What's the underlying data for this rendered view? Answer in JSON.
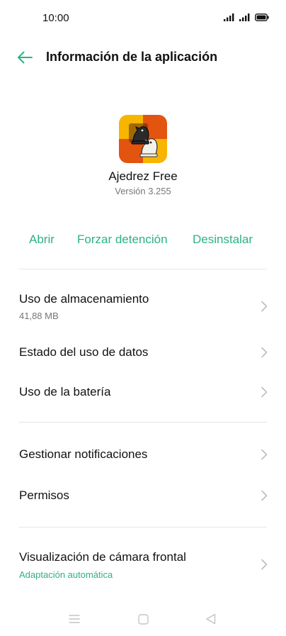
{
  "status_bar": {
    "time": "10:00",
    "icons": [
      "signal-icon",
      "signal-icon",
      "battery-icon"
    ]
  },
  "header": {
    "title": "Información de la aplicación",
    "back_icon": "arrow-left-icon"
  },
  "app": {
    "name": "Ajedrez Free",
    "version": "Versión 3.255",
    "icon": "chess-knights-icon"
  },
  "actions": {
    "open": "Abrir",
    "force_stop": "Forzar detención",
    "uninstall": "Desinstalar"
  },
  "settings": {
    "storage": {
      "title": "Uso de almacenamiento",
      "subtitle": "41,88 MB"
    },
    "data_usage": {
      "title": "Estado del uso de datos"
    },
    "battery": {
      "title": "Uso de la batería"
    },
    "notifications": {
      "title": "Gestionar notificaciones"
    },
    "permissions": {
      "title": "Permisos"
    },
    "front_camera": {
      "title": "Visualización de cámara frontal",
      "subtitle": "Adaptación automática"
    }
  },
  "nav_bar": {
    "icons": [
      "menu-icon",
      "home-icon",
      "back-triangle-icon"
    ]
  },
  "colors": {
    "accent": "#2bb383",
    "text": "#111111",
    "secondary_text": "#777777",
    "divider": "#e6e6e6"
  }
}
